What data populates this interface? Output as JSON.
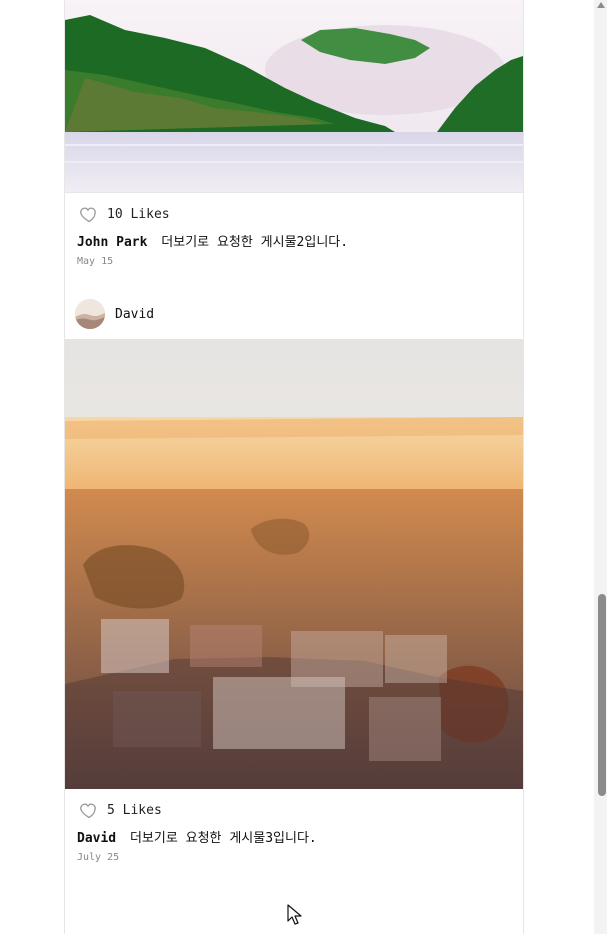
{
  "posts": [
    {
      "likes_text": "10 Likes",
      "caption_user": "John Park",
      "caption_text": "더보기로 요청한 게시물2입니다.",
      "date": "May 15"
    },
    {
      "username": "David",
      "likes_text": "5 Likes",
      "caption_user": "David",
      "caption_text": "더보기로 요청한 게시물3입니다.",
      "date": "July 25"
    }
  ],
  "icons": {
    "like": "heart-icon",
    "avatar": "avatar-image",
    "scroll_up": "chevron-up-icon",
    "cursor": "mouse-cursor-icon"
  },
  "colors": {
    "text": "#111111",
    "muted": "#888888",
    "border": "#e6e6e6",
    "scrollbar": "#8b8b8b"
  }
}
